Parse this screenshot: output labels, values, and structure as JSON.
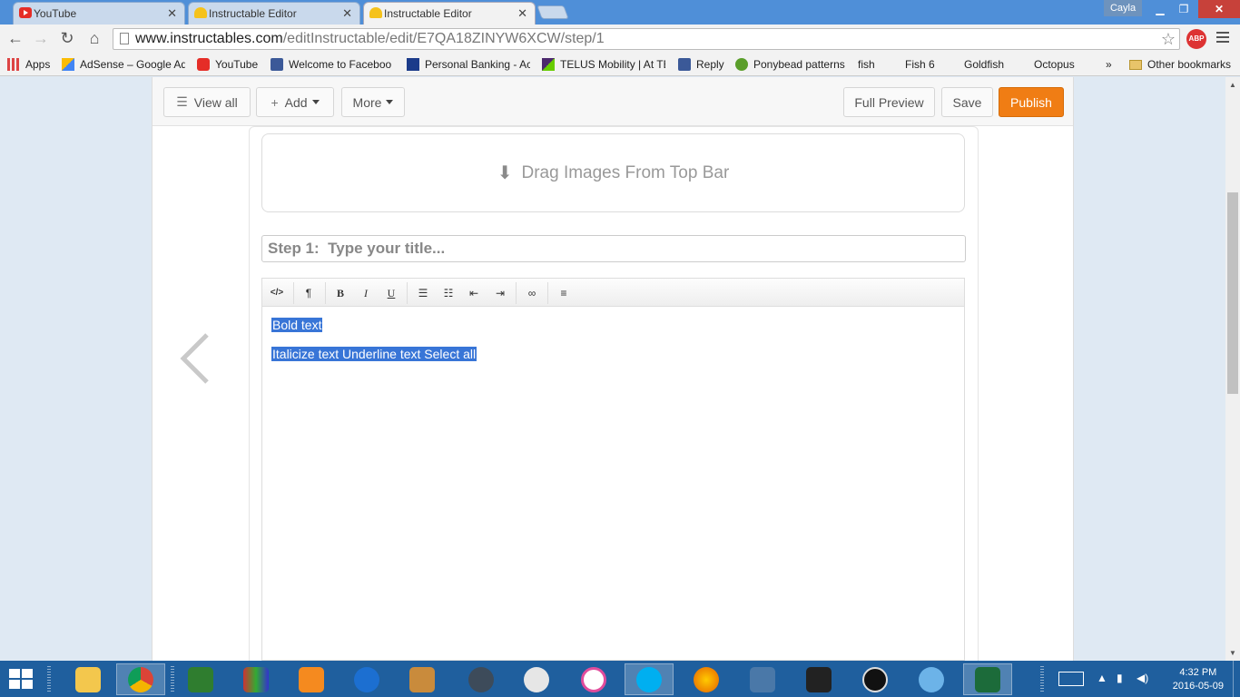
{
  "browser": {
    "tabs": [
      {
        "title": "YouTube",
        "icon": "youtube-icon",
        "active": false
      },
      {
        "title": "Instructable Editor",
        "icon": "instructables-robot-icon",
        "active": false
      },
      {
        "title": "Instructable Editor",
        "icon": "instructables-robot-icon",
        "active": true
      }
    ],
    "profile_name": "Cayla",
    "url_host": "www.instructables.com",
    "url_path": "/editInstructable/edit/E7QA18ZINYW6XCW/step/1",
    "adblock_label": "ABP",
    "bookmarks": [
      {
        "label": "Apps",
        "icon": "apps-grid-icon"
      },
      {
        "label": "AdSense – Google Ad",
        "icon": "adsense-icon"
      },
      {
        "label": "YouTube",
        "icon": "youtube-icon"
      },
      {
        "label": "Welcome to Faceboo",
        "icon": "facebook-icon"
      },
      {
        "label": "Personal Banking - Ac",
        "icon": "bank-icon"
      },
      {
        "label": "TELUS Mobility | At TE",
        "icon": "telus-icon"
      },
      {
        "label": "Reply",
        "icon": "facebook-icon"
      },
      {
        "label": "Ponybead patterns",
        "icon": "ponybead-icon"
      },
      {
        "label": "fish",
        "icon": "page-icon"
      },
      {
        "label": "Fish 6",
        "icon": "page-icon"
      },
      {
        "label": "Goldfish",
        "icon": "page-icon"
      },
      {
        "label": "Octopus",
        "icon": "page-icon"
      }
    ],
    "more_bookmarks": "»",
    "other_bookmarks": "Other bookmarks"
  },
  "editor": {
    "toolbar": {
      "view_all": "View all",
      "add": "Add",
      "more": "More",
      "full_preview": "Full Preview",
      "save": "Save",
      "publish": "Publish"
    },
    "dropzone_text": "Drag Images From Top Bar",
    "title_placeholder": "Step 1:  Type your title...",
    "rte_buttons": {
      "source": "</>",
      "paragraph": "¶",
      "bold": "B",
      "italic": "I",
      "underline": "U"
    },
    "body_lines": [
      "Bold text ",
      "Italicize text Underline text Select all"
    ],
    "accent_color": "#f07d14",
    "selection_color": "#3875d7"
  },
  "taskbar": {
    "time": "4:32 PM",
    "date": "2016-05-09",
    "apps": [
      "file-explorer-icon",
      "chrome-icon",
      "wondershare-icon",
      "winrar-icon",
      "media-player-icon",
      "malwarebytes-icon",
      "game-icon",
      "video-editor-icon",
      "webcam-icon",
      "itunes-icon",
      "skype-icon",
      "firefox-icon",
      "remote-desktop-icon",
      "hat-app-icon",
      "media-play-icon",
      "safari-icon",
      "solitaire-icon"
    ]
  }
}
